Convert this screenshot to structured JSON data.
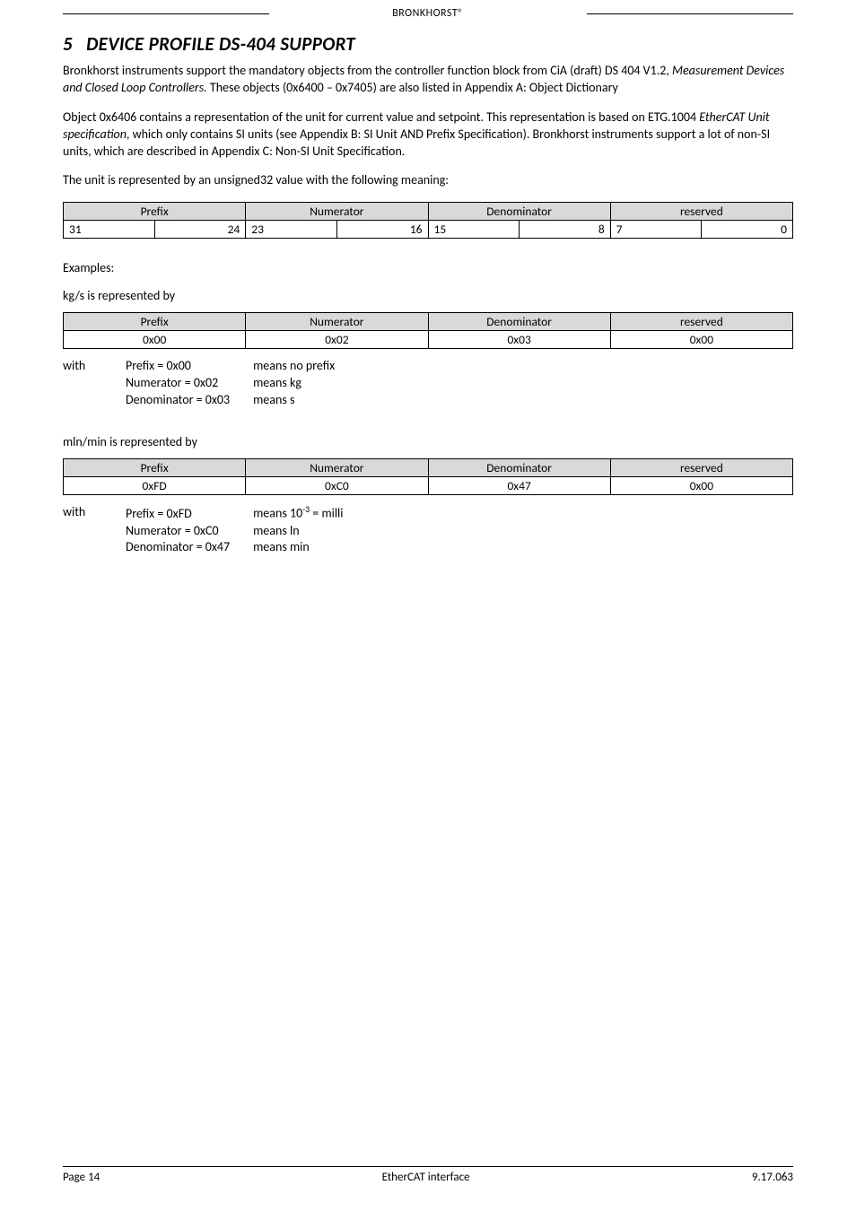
{
  "header": {
    "brand": "BRONKHORST®"
  },
  "section": {
    "number": "5",
    "title": "DEVICE PROFILE DS-404 SUPPORT"
  },
  "paragraphs": {
    "p1a": "Bronkhorst instruments support the mandatory objects from the controller function block from CiA (draft) DS 404 V1.2, ",
    "p1b": "Measurement Devices and Closed Loop Controllers.",
    "p1c": " These objects (0x6400 – 0x7405) are also listed in Appendix A: Object Dictionary",
    "p2a": "Object 0x6406 contains a representation of the unit for current value and setpoint. This representation is based on ETG.1004 ",
    "p2b": "EtherCAT Unit specification",
    "p2c": ", which only contains SI units (see Appendix B: SI Unit AND Prefix Specification). Bronkhorst instruments support a lot of non-SI units, which are described in Appendix C: Non-SI Unit Specification.",
    "p3": "The unit is represented by an unsigned32 value with the following meaning:"
  },
  "bit_table": {
    "headers": [
      "Prefix",
      "Numerator",
      "Denominator",
      "reserved"
    ],
    "cells": [
      "31",
      "24",
      "23",
      "16",
      "15",
      "8",
      "7",
      "0"
    ]
  },
  "labels": {
    "examples": "Examples:",
    "ex1": "kg/s is represented by",
    "ex2": "mln/min is represented by",
    "with": "with"
  },
  "columns": [
    "Prefix",
    "Numerator",
    "Denominator",
    "reserved"
  ],
  "example1": {
    "values": [
      "0x00",
      "0x02",
      "0x03",
      "0x00"
    ],
    "defs": [
      {
        "k": "Prefix = 0x00",
        "m": "means no prefix"
      },
      {
        "k": "Numerator = 0x02",
        "m": "means kg"
      },
      {
        "k": "Denominator = 0x03",
        "m": "means s"
      }
    ]
  },
  "example2": {
    "values": [
      "0xFD",
      "0xC0",
      "0x47",
      "0x00"
    ],
    "defs": [
      {
        "k": "Prefix = 0xFD",
        "m_pre": "means 10",
        "m_sup": "-3",
        "m_post": " = milli"
      },
      {
        "k": "Numerator = 0xC0",
        "m": "means ln"
      },
      {
        "k": "Denominator = 0x47",
        "m": "means min"
      }
    ]
  },
  "footer": {
    "left": "Page 14",
    "center": "EtherCAT interface",
    "right": "9.17.063"
  }
}
